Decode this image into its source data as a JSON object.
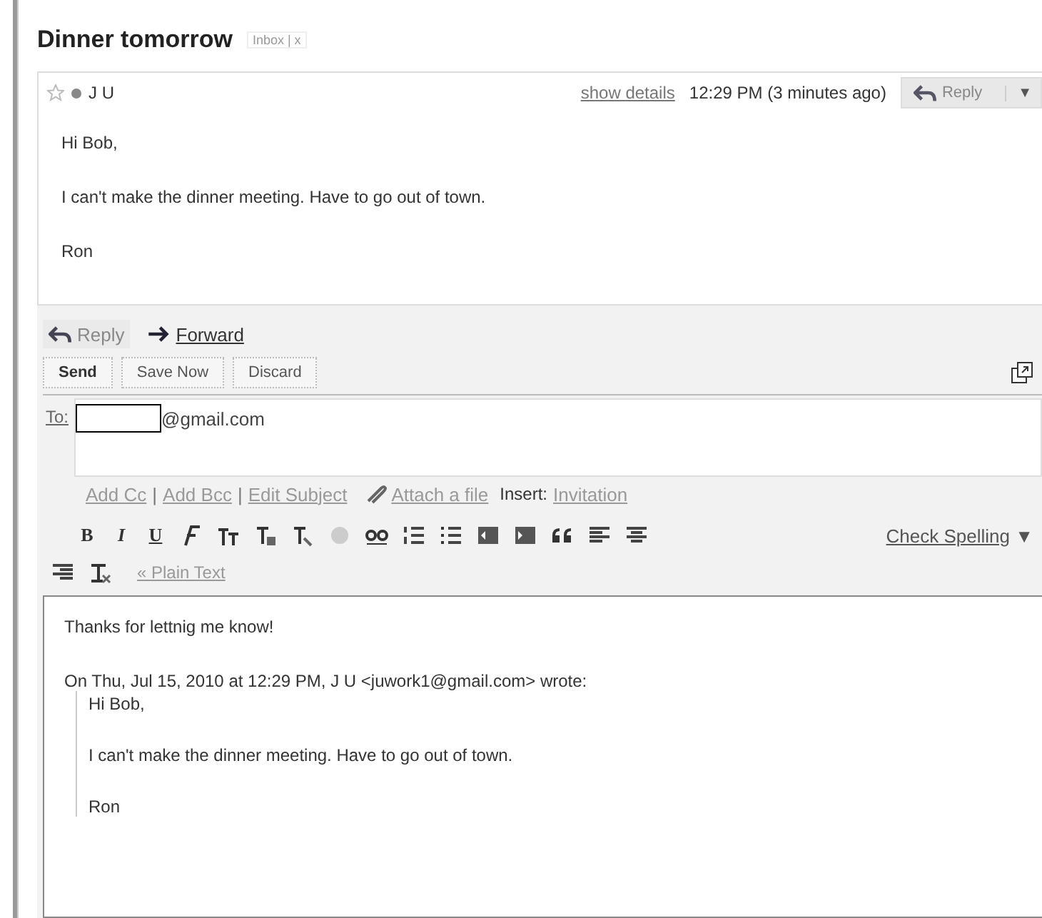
{
  "thread": {
    "subject": "Dinner tomorrow",
    "label": "Inbox",
    "label_separator": "|",
    "label_remove": "x"
  },
  "message": {
    "starred": false,
    "sender": "J U",
    "show_details": "show details",
    "time": "12:29 PM (3 minutes ago)",
    "reply_button": "Reply",
    "menu_caret": "▼",
    "body": [
      "Hi Bob,",
      "I can't make the dinner meeting. Have to go out of town.",
      "Ron"
    ]
  },
  "compose": {
    "tabs": [
      {
        "label": "Reply",
        "selected": true
      },
      {
        "label": "Forward",
        "selected": false
      }
    ],
    "buttons": [
      "Send",
      "Save Now",
      "Discard"
    ],
    "to_label": "To:",
    "to_value": "@gmail.com",
    "links": [
      {
        "kind": "link",
        "text": "Add Cc"
      },
      {
        "kind": "sep",
        "text": "|"
      },
      {
        "kind": "link",
        "text": "Add Bcc"
      },
      {
        "kind": "sep",
        "text": "|"
      },
      {
        "kind": "link",
        "text": "Edit Subject"
      },
      {
        "kind": "attach",
        "text": "Attach a file"
      },
      {
        "kind": "label",
        "text": "Insert:"
      },
      {
        "kind": "link",
        "text": "Invitation"
      }
    ],
    "format_letters": [
      "B",
      "I",
      "U"
    ],
    "check_spelling": "Check Spelling",
    "check_caret": "▼",
    "plain_text": "« Plain Text",
    "body": {
      "reply": "Thanks for lettnig me know!",
      "attribution": "On Thu, Jul 15, 2010 at 12:29 PM, J U <juwork1@gmail.com> wrote:",
      "quote": [
        "Hi Bob,",
        "I can't make the dinner meeting. Have to go out of town.",
        "Ron"
      ]
    }
  }
}
